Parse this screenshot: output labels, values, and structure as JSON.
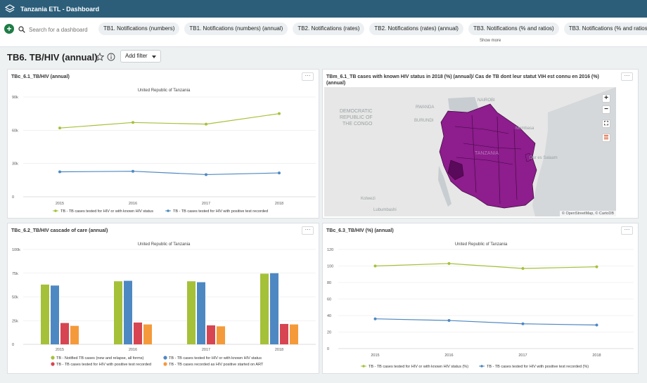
{
  "app": {
    "title": "Tanzania ETL - Dashboard",
    "logo": "layers-logo-icon"
  },
  "search": {
    "placeholder": "Search for a dashboard"
  },
  "tabs": [
    "TB1. Notifications (numbers)",
    "TB1. Notifications (numbers) (annual)",
    "TB2. Notifications (rates)",
    "TB2. Notifications (rates) (annual)",
    "TB3. Notifications (% and ratios)",
    "TB3. Notifications (% and ratios) (annual)"
  ],
  "show_more": "Show more",
  "page": {
    "title": "TB6. TB/HIV (annual)",
    "add_filter": "Add filter"
  },
  "colors": {
    "green": "#a5c13a",
    "blue": "#4e88c2",
    "red": "#d64551",
    "orange": "#f49a3a",
    "purple": "#8e1d8e",
    "topbar": "#2c5e7a"
  },
  "panels": {
    "p1": {
      "title": "TBc_6.1_TB/HIV (annual)",
      "more": "···"
    },
    "p2": {
      "title": "TBm_6.1_TB cases with known HIV status in 2018 (%) (annual)/ Cas de TB dont leur statut VIH est connu en 2016 (%) (annual)",
      "more": "···",
      "map_labels": [
        "DEMOCRATIC",
        "REPUBLIC OF",
        "THE CONGO",
        "RWANDA",
        "BURUNDI",
        "NAIROBI",
        "Mombasa",
        "Dar es Salaam",
        "TANZANIA",
        "Kolwezi",
        "Lubumbashi"
      ],
      "controls": [
        "+",
        "−"
      ],
      "attribution": "© OpenStreetMap, © CartoDB"
    },
    "p3": {
      "title": "TBc_6.2_TB/HIV cascade of care (annual)",
      "more": "···"
    },
    "p4": {
      "title": "TBc_6.3_TB/HIV (%) (annual)",
      "more": "···"
    }
  },
  "chart_data": [
    {
      "type": "line",
      "subtitle": "United Republic of Tanzania",
      "x": [
        "2015",
        "2016",
        "2017",
        "2018"
      ],
      "ylim": [
        0,
        90000
      ],
      "yticks": [
        0,
        30000,
        60000,
        90000
      ],
      "ytick_labels": [
        "0",
        "30k",
        "60k",
        "90k"
      ],
      "series": [
        {
          "name": "TB - TB cases tested for HIV or with known HIV status",
          "color": "#a5c13a",
          "values": [
            62000,
            67000,
            65500,
            75000
          ]
        },
        {
          "name": "TB - TB cases tested for HIV with positive test recorded",
          "color": "#4e88c2",
          "values": [
            22500,
            23000,
            20000,
            21500
          ]
        }
      ]
    },
    {
      "type": "bar",
      "subtitle": "United Republic of Tanzania",
      "categories": [
        "2015",
        "2016",
        "2017",
        "2018"
      ],
      "ylim": [
        0,
        100000
      ],
      "yticks": [
        0,
        25000,
        50000,
        75000,
        100000
      ],
      "ytick_labels": [
        "0",
        "25k",
        "50k",
        "75k",
        "100k"
      ],
      "series": [
        {
          "name": "TB - Notified TB cases (new and relapse, all forms)",
          "color": "#a5c13a",
          "values": [
            63000,
            66500,
            66500,
            74500
          ]
        },
        {
          "name": "TB - TB cases tested for HIV or with known HIV status",
          "color": "#4e88c2",
          "values": [
            62000,
            67000,
            65500,
            75000
          ]
        },
        {
          "name": "TB - TB cases tested for HIV with positive test recorded",
          "color": "#d64551",
          "values": [
            22500,
            23000,
            20000,
            21500
          ]
        },
        {
          "name": "TB - TB cases recorded as HIV positive started on ART",
          "color": "#f49a3a",
          "values": [
            19500,
            21000,
            19000,
            21000
          ]
        }
      ]
    },
    {
      "type": "line",
      "subtitle": "United Republic of Tanzania",
      "x": [
        "2015",
        "2016",
        "2017",
        "2018"
      ],
      "ylim": [
        0,
        120
      ],
      "yticks": [
        0,
        20,
        40,
        60,
        80,
        100,
        120
      ],
      "ytick_labels": [
        "0",
        "20",
        "40",
        "60",
        "80",
        "100",
        "120"
      ],
      "series": [
        {
          "name": "TB - TB cases tested for HIV or with known HIV status (%)",
          "color": "#a5c13a",
          "values": [
            100,
            103,
            97,
            99
          ]
        },
        {
          "name": "TB - TB cases tested for HIV with positive test recorded (%)",
          "color": "#4e88c2",
          "values": [
            36,
            34,
            30,
            28.5
          ]
        }
      ]
    }
  ]
}
